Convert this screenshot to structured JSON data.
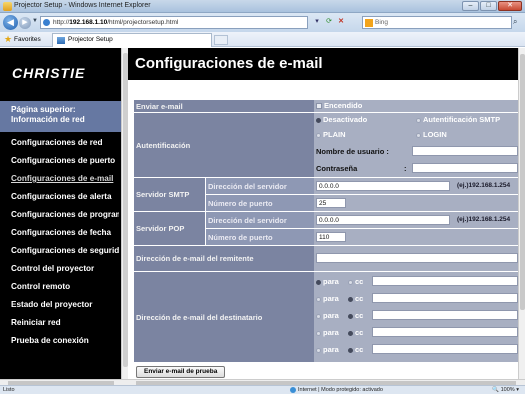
{
  "window": {
    "title": "Projector Setup - Windows Internet Explorer",
    "minimize": "–",
    "maximize": "□",
    "close": "✕"
  },
  "address": {
    "url_prefix": "http://",
    "url_host": "192.168.1.10",
    "url_path": "/html/projectorsetup.html",
    "search_placeholder": "Bing"
  },
  "favorites": {
    "label": "Favorites",
    "tab_title": "Projector Setup"
  },
  "sidebar": {
    "logo": "CHRISTIE",
    "top_link": "Página superior: Información de red",
    "items": [
      {
        "label": "Configuraciones de red"
      },
      {
        "label": "Configuraciones de puerto"
      },
      {
        "label": "Configuraciones de e-mail"
      },
      {
        "label": "Configuraciones de alerta"
      },
      {
        "label": "Configuraciones de programación"
      },
      {
        "label": "Configuraciones de fecha"
      },
      {
        "label": "Configuraciones de seguridad"
      },
      {
        "label": "Control del proyector"
      },
      {
        "label": "Control remoto"
      },
      {
        "label": "Estado del proyector"
      },
      {
        "label": "Reiniciar red"
      },
      {
        "label": "Prueba de conexión"
      }
    ],
    "active_index": 2
  },
  "page": {
    "title": "Configuraciones de e-mail"
  },
  "form": {
    "enviar_label": "Enviar e-mail",
    "enviar_option": "Encendido",
    "auth_label": "Autentificación",
    "auth_opt_off": "Desactivado",
    "auth_opt_smtp": "Autentificación SMTP",
    "auth_opt_plain": "PLAIN",
    "auth_opt_login": "LOGIN",
    "username_label": "Nombre de usuario :",
    "username_value": "",
    "password_label": "Contraseña",
    "password_colon": ":",
    "password_value": "",
    "smtp_label": "Servidor SMTP",
    "smtp_addr_label": "Dirección del servidor",
    "smtp_addr_value": "0.0.0.0",
    "smtp_example": "(ej.)192.168.1.254",
    "smtp_port_label": "Número de puerto",
    "smtp_port_value": "25",
    "pop_label": "Servidor POP",
    "pop_addr_label": "Dirección del servidor",
    "pop_addr_value": "0.0.0.0",
    "pop_example": "(ej.)192.168.1.254",
    "pop_port_label": "Número de puerto",
    "pop_port_value": "110",
    "sender_label": "Dirección de e-mail del remitente",
    "sender_value": "",
    "dest_label": "Dirección de e-mail del destinatario",
    "dest_rows": [
      {
        "para": "para",
        "cc": "cc",
        "selected": "para",
        "value": ""
      },
      {
        "para": "para",
        "cc": "cc",
        "selected": "cc",
        "value": ""
      },
      {
        "para": "para",
        "cc": "cc",
        "selected": "cc",
        "value": ""
      },
      {
        "para": "para",
        "cc": "cc",
        "selected": "cc",
        "value": ""
      },
      {
        "para": "para",
        "cc": "cc",
        "selected": "cc",
        "value": ""
      }
    ],
    "test_button": "Enviar e-mail de prueba"
  },
  "status": {
    "left": "Listo",
    "zone": "Internet | Modo protegido: activado",
    "zoom": "100%"
  }
}
